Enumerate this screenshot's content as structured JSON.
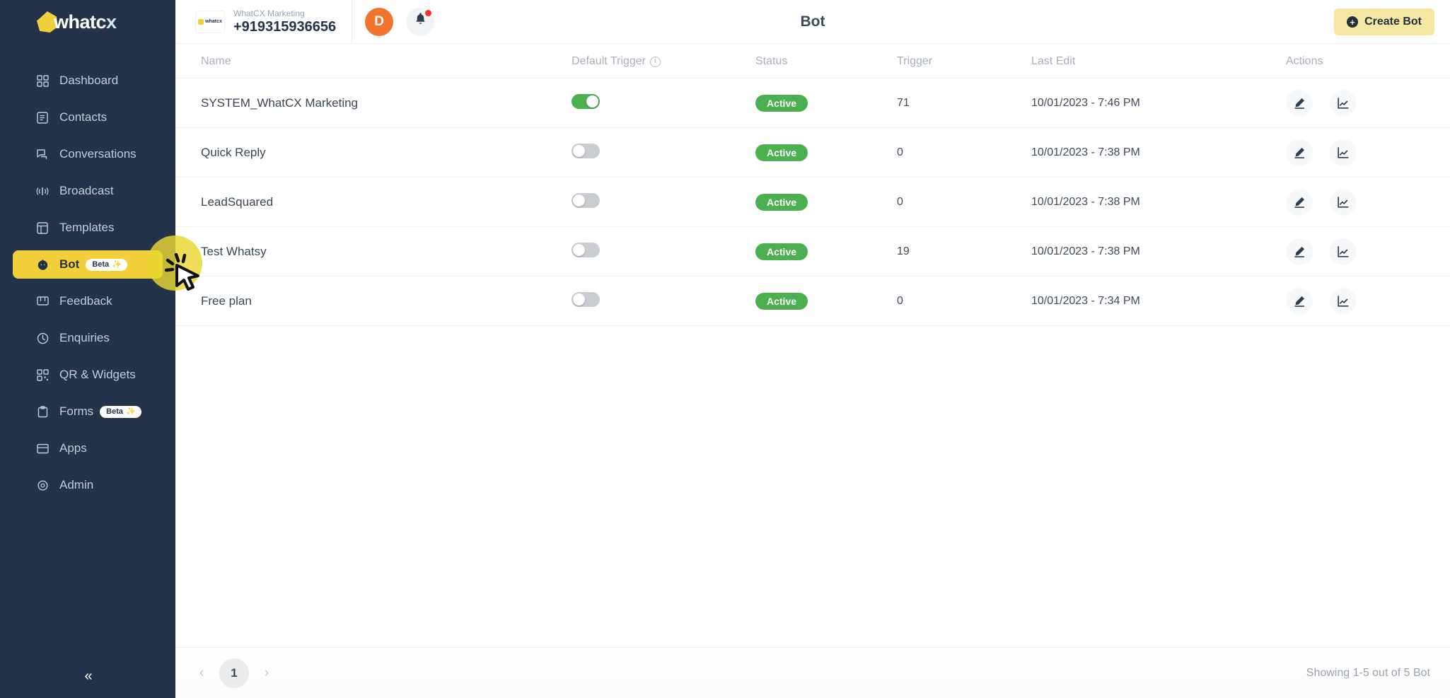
{
  "brand": {
    "name": "whatcx",
    "logo_icon": "whatcx-hexagon-logo",
    "accent_yellow": "#f2d03b",
    "sidebar_bg": "#23344a"
  },
  "sidebar": {
    "items": [
      {
        "label": "Dashboard",
        "icon": "grid-icon",
        "active": false,
        "badge": null
      },
      {
        "label": "Contacts",
        "icon": "contact-card-icon",
        "active": false,
        "badge": null
      },
      {
        "label": "Conversations",
        "icon": "chat-bubbles-icon",
        "active": false,
        "badge": null
      },
      {
        "label": "Broadcast",
        "icon": "broadcast-icon",
        "active": false,
        "badge": null
      },
      {
        "label": "Templates",
        "icon": "template-icon",
        "active": false,
        "badge": null
      },
      {
        "label": "Bot",
        "icon": "bot-icon",
        "active": true,
        "badge": "Beta"
      },
      {
        "label": "Feedback",
        "icon": "feedback-icon",
        "active": false,
        "badge": null
      },
      {
        "label": "Enquiries",
        "icon": "enquiry-icon",
        "active": false,
        "badge": null
      },
      {
        "label": "QR & Widgets",
        "icon": "qr-icon",
        "active": false,
        "badge": null
      },
      {
        "label": "Forms",
        "icon": "forms-icon",
        "active": false,
        "badge": "Beta"
      },
      {
        "label": "Apps",
        "icon": "apps-icon",
        "active": false,
        "badge": null
      },
      {
        "label": "Admin",
        "icon": "admin-gear-icon",
        "active": false,
        "badge": null
      }
    ],
    "badge_sparkle": "✨",
    "collapse_label": "«"
  },
  "topbar": {
    "account_name": "WhatCX Marketing",
    "account_phone": "+919315936656",
    "account_logo_text": "whatcx",
    "avatar_initial": "D",
    "avatar_color": "#f0742b",
    "bell_icon": "notification-bell-icon",
    "bell_has_unread": true,
    "page_title": "Bot",
    "create_button_label": "Create Bot",
    "create_button_icon": "plus-circle-icon",
    "create_button_color": "#f5e6a3"
  },
  "table": {
    "columns": [
      {
        "key": "name",
        "label": "Name",
        "info": false
      },
      {
        "key": "toggle",
        "label": "Default Trigger",
        "info": true
      },
      {
        "key": "status",
        "label": "Status",
        "info": false
      },
      {
        "key": "trigger",
        "label": "Trigger",
        "info": false
      },
      {
        "key": "edit",
        "label": "Last Edit",
        "info": false
      },
      {
        "key": "actions",
        "label": "Actions",
        "info": false
      }
    ],
    "rows": [
      {
        "name": "SYSTEM_WhatCX Marketing",
        "default_trigger_on": true,
        "status": "Active",
        "trigger": "71",
        "last_edit": "10/01/2023 - 7:46 PM"
      },
      {
        "name": "Quick Reply",
        "default_trigger_on": false,
        "status": "Active",
        "trigger": "0",
        "last_edit": "10/01/2023 - 7:38 PM"
      },
      {
        "name": "LeadSquared",
        "default_trigger_on": false,
        "status": "Active",
        "trigger": "0",
        "last_edit": "10/01/2023 - 7:38 PM"
      },
      {
        "name": "Test Whatsy",
        "default_trigger_on": false,
        "status": "Active",
        "trigger": "19",
        "last_edit": "10/01/2023 - 7:38 PM"
      },
      {
        "name": "Free plan",
        "default_trigger_on": false,
        "status": "Active",
        "trigger": "0",
        "last_edit": "10/01/2023 - 7:34 PM"
      }
    ],
    "row_actions": [
      {
        "icon": "edit-pencil-icon",
        "name": "edit-bot-button"
      },
      {
        "icon": "analytics-chart-icon",
        "name": "bot-analytics-button"
      }
    ],
    "status_color": "#4caf50",
    "toggle_on_color": "#4caf50",
    "toggle_off_color": "#c9ccd1"
  },
  "footer": {
    "prev_label": "‹",
    "next_label": "›",
    "current_page": "1",
    "showing_text": "Showing 1-5 out of 5 Bot"
  }
}
